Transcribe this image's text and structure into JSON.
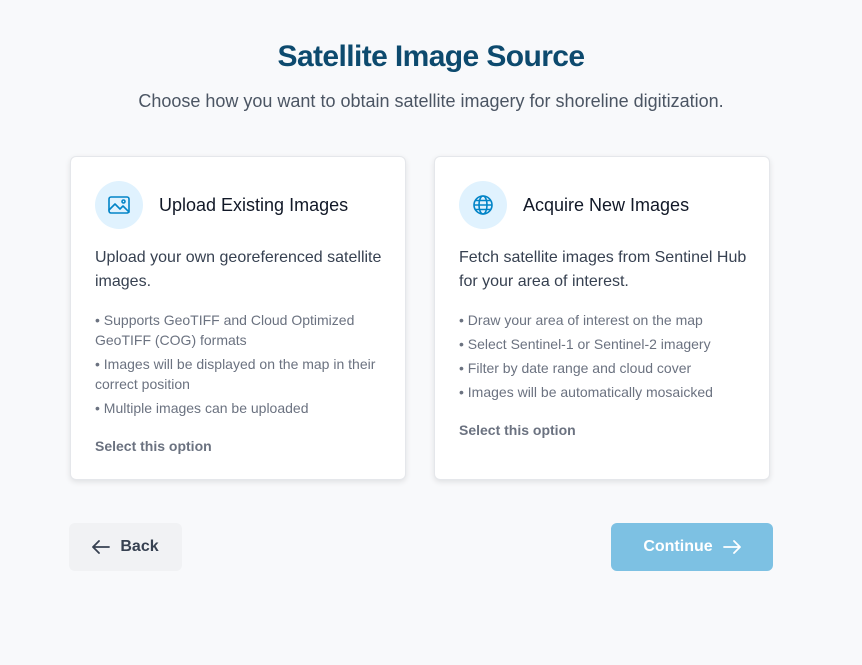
{
  "header": {
    "title": "Satellite Image Source",
    "subtitle": "Choose how you want to obtain satellite imagery for shoreline digitization."
  },
  "options": [
    {
      "icon": "image-icon",
      "title": "Upload Existing Images",
      "description": "Upload your own georeferenced satellite images.",
      "bullets": [
        "• Supports GeoTIFF and Cloud Optimized GeoTIFF (COG) formats",
        "• Images will be displayed on the map in their correct position",
        "• Multiple images can be uploaded"
      ],
      "select_label": "Select this option"
    },
    {
      "icon": "globe-icon",
      "title": "Acquire New Images",
      "description": "Fetch satellite images from Sentinel Hub for your area of interest.",
      "bullets": [
        "• Draw your area of interest on the map",
        "• Select Sentinel-1 or Sentinel-2 imagery",
        "• Filter by date range and cloud cover",
        "• Images will be automatically mosaicked"
      ],
      "select_label": "Select this option"
    }
  ],
  "footer": {
    "back_label": "Back",
    "continue_label": "Continue"
  },
  "colors": {
    "title": "#0d4a6e",
    "accent": "#0284c7",
    "icon_bg": "#e0f2fe",
    "continue_bg": "#7dc1e3"
  }
}
